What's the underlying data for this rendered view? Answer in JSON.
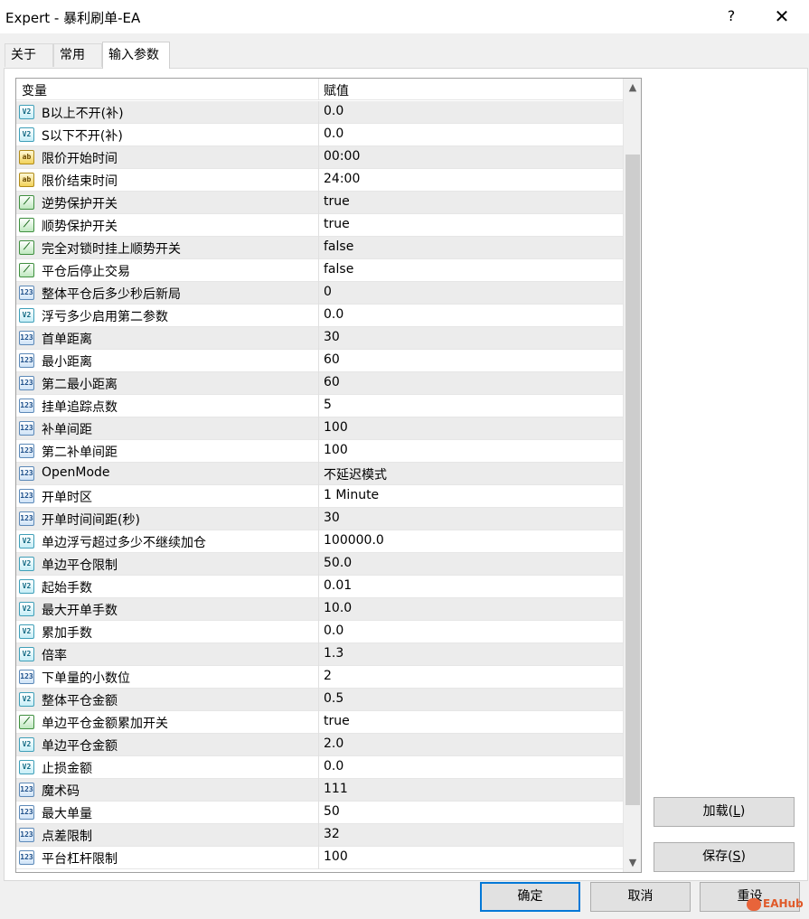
{
  "window": {
    "title": "Expert - 暴利刷单-EA",
    "help": "?",
    "close": "✕"
  },
  "tabs": [
    {
      "label": "关于"
    },
    {
      "label": "常用"
    },
    {
      "label": "输入参数"
    }
  ],
  "grid": {
    "headers": {
      "variable": "变量",
      "value": "赋值"
    },
    "rows": [
      {
        "icon": "V2",
        "name": "B以上不开(补)",
        "value": "0.0"
      },
      {
        "icon": "V2",
        "name": "S以下不开(补)",
        "value": "0.0"
      },
      {
        "icon": "ab",
        "name": "限价开始时间",
        "value": "00:00"
      },
      {
        "icon": "ab",
        "name": "限价结束时间",
        "value": "24:00"
      },
      {
        "icon": "⟋",
        "name": "逆势保护开关",
        "value": "true"
      },
      {
        "icon": "⟋",
        "name": "顺势保护开关",
        "value": "true"
      },
      {
        "icon": "⟋",
        "name": "完全对锁时挂上顺势开关",
        "value": "false"
      },
      {
        "icon": "⟋",
        "name": "平仓后停止交易",
        "value": "false"
      },
      {
        "icon": "123",
        "name": "整体平仓后多少秒后新局",
        "value": "0"
      },
      {
        "icon": "V2",
        "name": "浮亏多少启用第二参数",
        "value": "0.0"
      },
      {
        "icon": "123",
        "name": "首单距离",
        "value": "30"
      },
      {
        "icon": "123",
        "name": "最小距离",
        "value": "60"
      },
      {
        "icon": "123",
        "name": "第二最小距离",
        "value": "60"
      },
      {
        "icon": "123",
        "name": "挂单追踪点数",
        "value": "5"
      },
      {
        "icon": "123",
        "name": "补单间距",
        "value": "100"
      },
      {
        "icon": "123",
        "name": "第二补单间距",
        "value": "100"
      },
      {
        "icon": "123",
        "name": "OpenMode",
        "value": "不延迟模式"
      },
      {
        "icon": "123",
        "name": "开单时区",
        "value": "1 Minute"
      },
      {
        "icon": "123",
        "name": "开单时间间距(秒)",
        "value": "30"
      },
      {
        "icon": "V2",
        "name": "单边浮亏超过多少不继续加仓",
        "value": "100000.0"
      },
      {
        "icon": "V2",
        "name": "单边平仓限制",
        "value": "50.0"
      },
      {
        "icon": "V2",
        "name": "起始手数",
        "value": "0.01"
      },
      {
        "icon": "V2",
        "name": "最大开单手数",
        "value": "10.0"
      },
      {
        "icon": "V2",
        "name": "累加手数",
        "value": "0.0"
      },
      {
        "icon": "V2",
        "name": "倍率",
        "value": "1.3"
      },
      {
        "icon": "123",
        "name": "下单量的小数位",
        "value": "2"
      },
      {
        "icon": "V2",
        "name": "整体平仓金额",
        "value": "0.5"
      },
      {
        "icon": "⟋",
        "name": "单边平仓金额累加开关",
        "value": "true"
      },
      {
        "icon": "V2",
        "name": "单边平仓金额",
        "value": "2.0"
      },
      {
        "icon": "V2",
        "name": "止损金额",
        "value": "0.0"
      },
      {
        "icon": "123",
        "name": "魔术码",
        "value": "111"
      },
      {
        "icon": "123",
        "name": "最大单量",
        "value": "50"
      },
      {
        "icon": "123",
        "name": "点差限制",
        "value": "32"
      },
      {
        "icon": "123",
        "name": "平台杠杆限制",
        "value": "100"
      }
    ]
  },
  "scrollbar": {
    "up": "▲",
    "down": "▼"
  },
  "buttons": {
    "load": "加载",
    "load_key": "L",
    "save": "保存",
    "save_key": "S",
    "ok": "确定",
    "cancel": "取消",
    "reset": "重设"
  },
  "watermark": {
    "text": "EAHub"
  }
}
